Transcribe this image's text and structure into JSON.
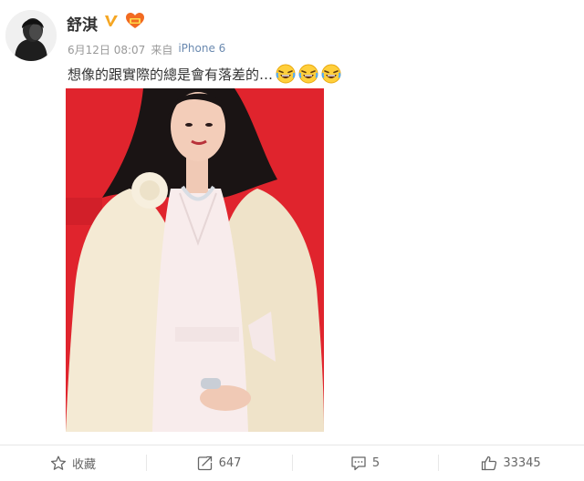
{
  "post": {
    "author": "舒淇",
    "timestamp": "6月12日 08:07",
    "source_prefix": "来自",
    "source_device": "iPhone 6",
    "text": "想像的跟實際的總是會有落差的…",
    "emoji_count": 3,
    "emoji_icon": "crying-face-icon"
  },
  "actions": {
    "favorite_label": "收藏",
    "repost_count": "647",
    "comment_count": "5",
    "like_count": "33345"
  },
  "colors": {
    "photo_background": "#e0242d",
    "vip_badge": "#f5a623",
    "link_blue": "#6b8ab0"
  }
}
